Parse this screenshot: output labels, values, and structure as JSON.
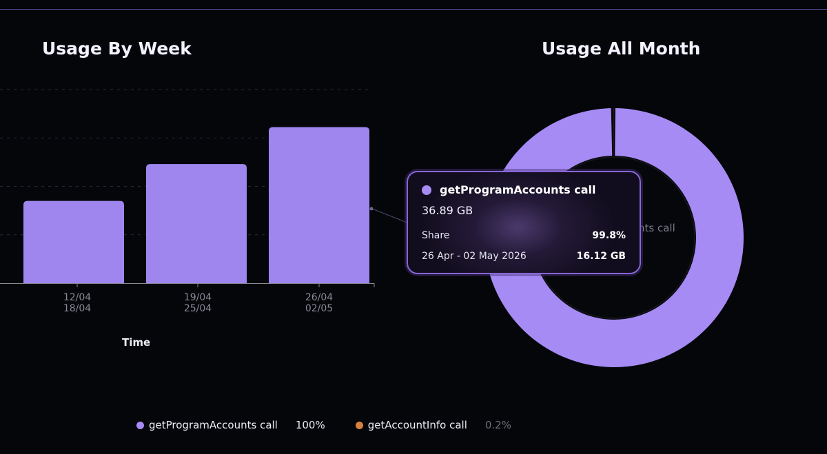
{
  "colors": {
    "primary": "#a68bf5",
    "primary_bar": "#9f86ef",
    "secondary": "#d6823e",
    "background": "#05060a"
  },
  "left_chart": {
    "title": "Usage By Week",
    "xlabel": "Time"
  },
  "right_chart": {
    "title": "Usage All Month",
    "center_label_partial": "nts call"
  },
  "tooltip": {
    "series_name": "getProgramAccounts call",
    "total_value": "36.89 GB",
    "share_label": "Share",
    "share_value": "99.8%",
    "week_label": "26 Apr - 02 May 2026",
    "week_value": "16.12 GB"
  },
  "legend": [
    {
      "name": "getProgramAccounts call",
      "percent": "100%",
      "color": "#a68bf5"
    },
    {
      "name": "getAccountInfo call",
      "percent": "0.2%",
      "color": "#d6823e"
    }
  ],
  "chart_data": [
    {
      "type": "bar",
      "title": "Usage By Week",
      "xlabel": "Time",
      "categories": [
        "12/04\n18/04",
        "19/04\n25/04",
        "26/04\n02/05"
      ],
      "series": [
        {
          "name": "getProgramAccounts call",
          "values": [
            8.5,
            12.3,
            16.12
          ]
        }
      ],
      "unit": "GB",
      "ylim": [
        0,
        20
      ],
      "grid": true
    },
    {
      "type": "pie",
      "title": "Usage All Month",
      "donut": true,
      "labels": [
        "getProgramAccounts call",
        "getAccountInfo call"
      ],
      "values": [
        99.8,
        0.2
      ],
      "legend": "bottom"
    }
  ]
}
